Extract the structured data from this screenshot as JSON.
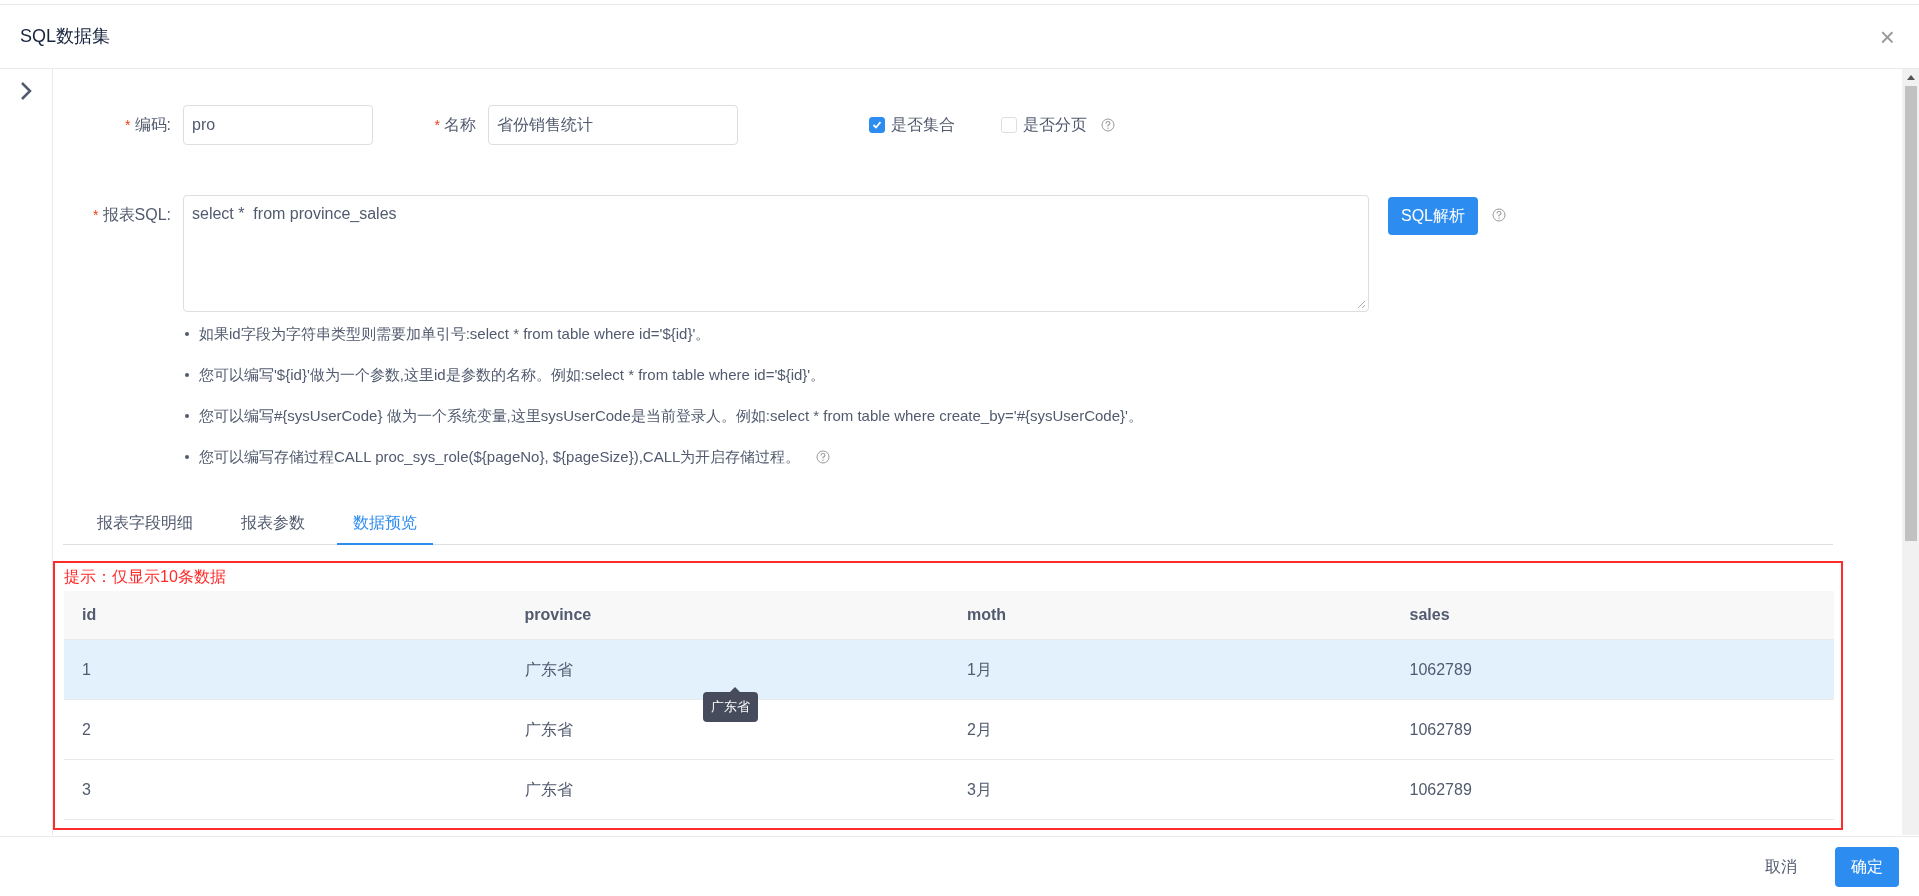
{
  "dialog": {
    "title": "SQL数据集",
    "close_icon": "×"
  },
  "form": {
    "code": {
      "required_mark": "*",
      "label": "编码:",
      "value": "pro"
    },
    "name": {
      "required_mark": "*",
      "label": "名称",
      "value": "省份销售统计"
    },
    "checkboxes": [
      {
        "label": "是否集合",
        "checked": true,
        "help": false
      },
      {
        "label": "是否分页",
        "checked": false,
        "help": true
      }
    ],
    "sql": {
      "required_mark": "*",
      "label": "报表SQL:",
      "value": "select *  from province_sales"
    },
    "parse_button": "SQL解析"
  },
  "hints": [
    {
      "text": "如果id字段为字符串类型则需要加单引号:select * from table where id='${id}'。",
      "help": false
    },
    {
      "text": "您可以编写'${id}'做为一个参数,这里id是参数的名称。例如:select * from table where id='${id}'。",
      "help": false
    },
    {
      "text": "您可以编写#{sysUserCode} 做为一个系统变量,这里sysUserCode是当前登录人。例如:select * from table where create_by='#{sysUserCode}'。",
      "help": false
    },
    {
      "text": "您可以编写存储过程CALL proc_sys_role(${pageNo}, ${pageSize}),CALL为开启存储过程。",
      "help": true
    }
  ],
  "tabs": [
    {
      "label": "报表字段明细",
      "selected": false
    },
    {
      "label": "报表参数",
      "selected": false
    },
    {
      "label": "数据预览",
      "selected": true
    }
  ],
  "preview": {
    "notice": "提示：仅显示10条数据",
    "table": {
      "columns": [
        "id",
        "province",
        "moth",
        "sales"
      ],
      "rows": [
        {
          "cells": [
            "1",
            "广东省",
            "1月",
            "1062789"
          ],
          "selected": true
        },
        {
          "cells": [
            "2",
            "广东省",
            "2月",
            "1062789"
          ],
          "selected": false
        },
        {
          "cells": [
            "3",
            "广东省",
            "3月",
            "1062789"
          ],
          "selected": false
        }
      ]
    },
    "tooltip": "广东省"
  },
  "footer": {
    "buttons": [
      {
        "label": "取消",
        "kind": "secondary"
      },
      {
        "label": "确定",
        "kind": "primary"
      }
    ]
  }
}
